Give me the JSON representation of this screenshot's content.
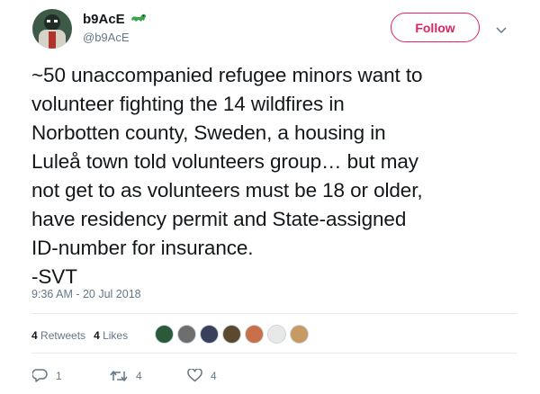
{
  "tweet": {
    "author": {
      "display_name": "b9AcE",
      "handle": "@b9AcE",
      "avatar_icon": "avatar-figure-icon",
      "badge_icon": "frog-emoji-icon"
    },
    "follow_label": "Follow",
    "menu_icon": "chevron-down-icon",
    "text": "~50 unaccompanied refugee minors want to\nvolunteer fighting the 14 wildfires in\nNorbotten county, Sweden, a housing in\nLuleå town told volunteers group… but may\nnot get to as volunteers must be 18 or older,\nhave residency permit and State-assigned\nID-number for insurance.\n-SVT",
    "timestamp": "9:36 AM - 20 Jul 2018",
    "stats": {
      "retweets_count": "4",
      "retweets_label": "Retweets",
      "likes_count": "4",
      "likes_label": "Likes"
    },
    "likers": [
      {
        "color": "#2b5a3a"
      },
      {
        "color": "#6e6e6e"
      },
      {
        "color": "#3a3f5c"
      },
      {
        "color": "#5b4a2f"
      },
      {
        "color": "#c96f4a"
      },
      {
        "color": "#e8e8e8"
      },
      {
        "color": "#c79a63"
      }
    ],
    "actions": {
      "reply_count": "1",
      "retweet_count": "4",
      "like_count": "4"
    },
    "colors": {
      "accent": "#e0245e",
      "muted": "#657786",
      "text": "#14171a",
      "frog": "#3aa64b"
    }
  }
}
